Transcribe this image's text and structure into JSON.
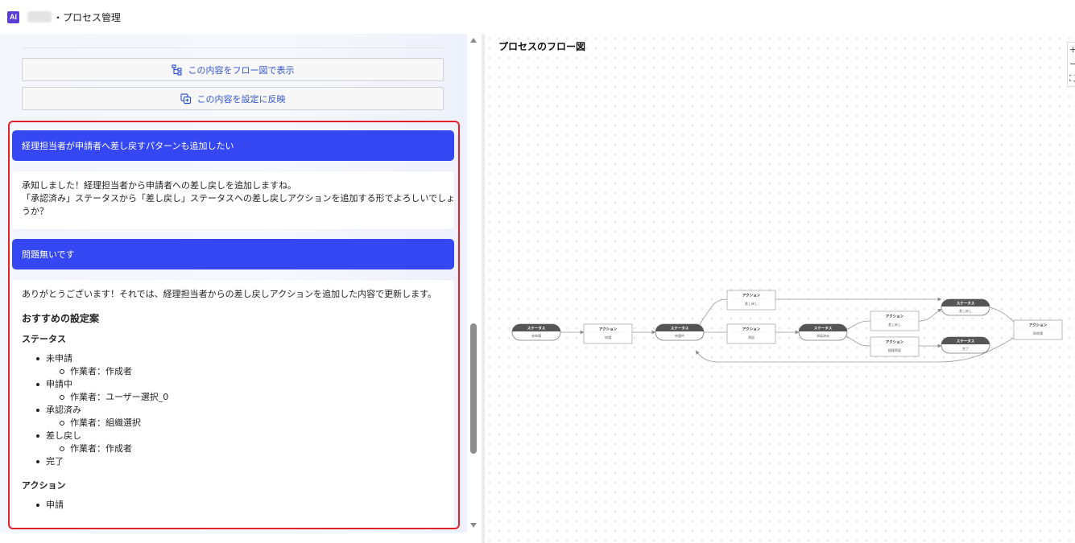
{
  "header": {
    "logo": "AI",
    "title": "・プロセス管理"
  },
  "left": {
    "buttons": {
      "show_flow": "この内容をフロー図で表示",
      "apply_settings": "この内容を設定に反映"
    },
    "messages": {
      "user_1": "経理担当者が申請者へ差し戻すパターンも追加したい",
      "bot_1_line_1": "承知しました！経理担当者から申請者への差し戻しを追加しますね。",
      "bot_1_line_2": "「承認済み」ステータスから「差し戻し」ステータスへの差し戻しアクションを追加する形でよろしいでしょ",
      "bot_1_line_3": "うか？",
      "user_2": "問題無いです",
      "bot_2_intro": "ありがとうございます！それでは、経理担当者からの差し戻しアクションを追加した内容で更新します。",
      "bot_2_heading": "おすすめの設定案",
      "status_heading": "ステータス",
      "statuses": [
        {
          "name": "未申請",
          "worker": "作業者：作成者"
        },
        {
          "name": "申請中",
          "worker": "作業者：ユーザー選択_0"
        },
        {
          "name": "承認済み",
          "worker": "作業者：組織選択"
        },
        {
          "name": "差し戻し",
          "worker": "作業者：作成者"
        },
        {
          "name": "完了",
          "worker": ""
        }
      ],
      "action_heading": "アクション",
      "actions": [
        {
          "name": "申請"
        }
      ]
    }
  },
  "right": {
    "title": "プロセスのフロー図",
    "zoom_in": "+",
    "zoom_out": "−",
    "fit": "⛶",
    "flow": {
      "status_label": "ステータス",
      "action_label": "アクション",
      "nodes": {
        "unapplied": "未申請",
        "apply_action": "申請",
        "in_progress": "申請中",
        "return_action_1": "差し戻し",
        "approve_action": "承認",
        "approved": "承認済み",
        "return_action_2": "差し戻し",
        "complete_action": "経理承認",
        "returned": "差し戻し",
        "done": "完了",
        "reapply_action": "再申請"
      }
    }
  }
}
